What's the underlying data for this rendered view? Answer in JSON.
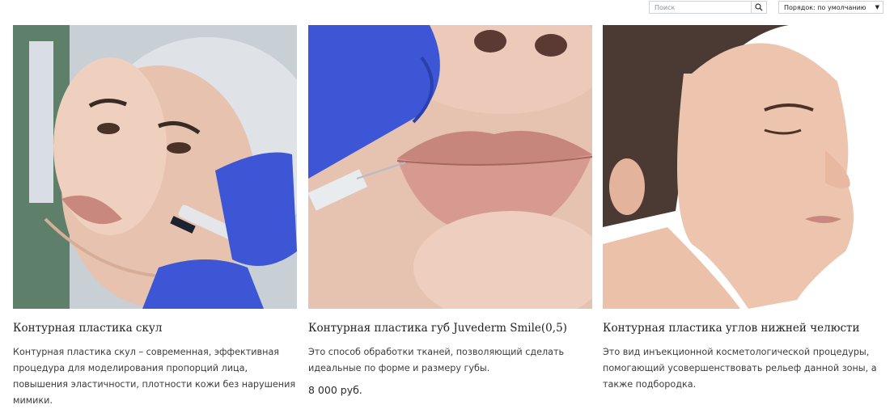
{
  "toolbar": {
    "search_placeholder": "Поиск",
    "sort_label": "Порядок: по умолчанию"
  },
  "products": [
    {
      "title": "Контурная пластика скул",
      "description": "Контурная пластика скул – современная, эффективная процедура для моделирования пропорций лица, повышения эластичности, плотности кожи без нарушения мимики.",
      "price": ""
    },
    {
      "title": "Контурная пластика губ Juvederm Smile(0,5)",
      "description": "Это способ обработки тканей, позволяющий сделать идеальные по форме и размеру губы.",
      "price": "8 000 руб."
    },
    {
      "title": "Контурная пластика углов нижней челюсти",
      "description": "Это вид инъекционной косметологической процедуры, помогающий усовершенствовать рельеф данной зоны, а также подбородка.",
      "price": ""
    }
  ],
  "colors": {
    "glove": "#3d56d6",
    "skin": "#e8c0ad",
    "lip": "#c98a80",
    "border": "#cfd3d6"
  },
  "icons": {
    "search": "search-icon",
    "sort": "chevron-down-icon"
  }
}
